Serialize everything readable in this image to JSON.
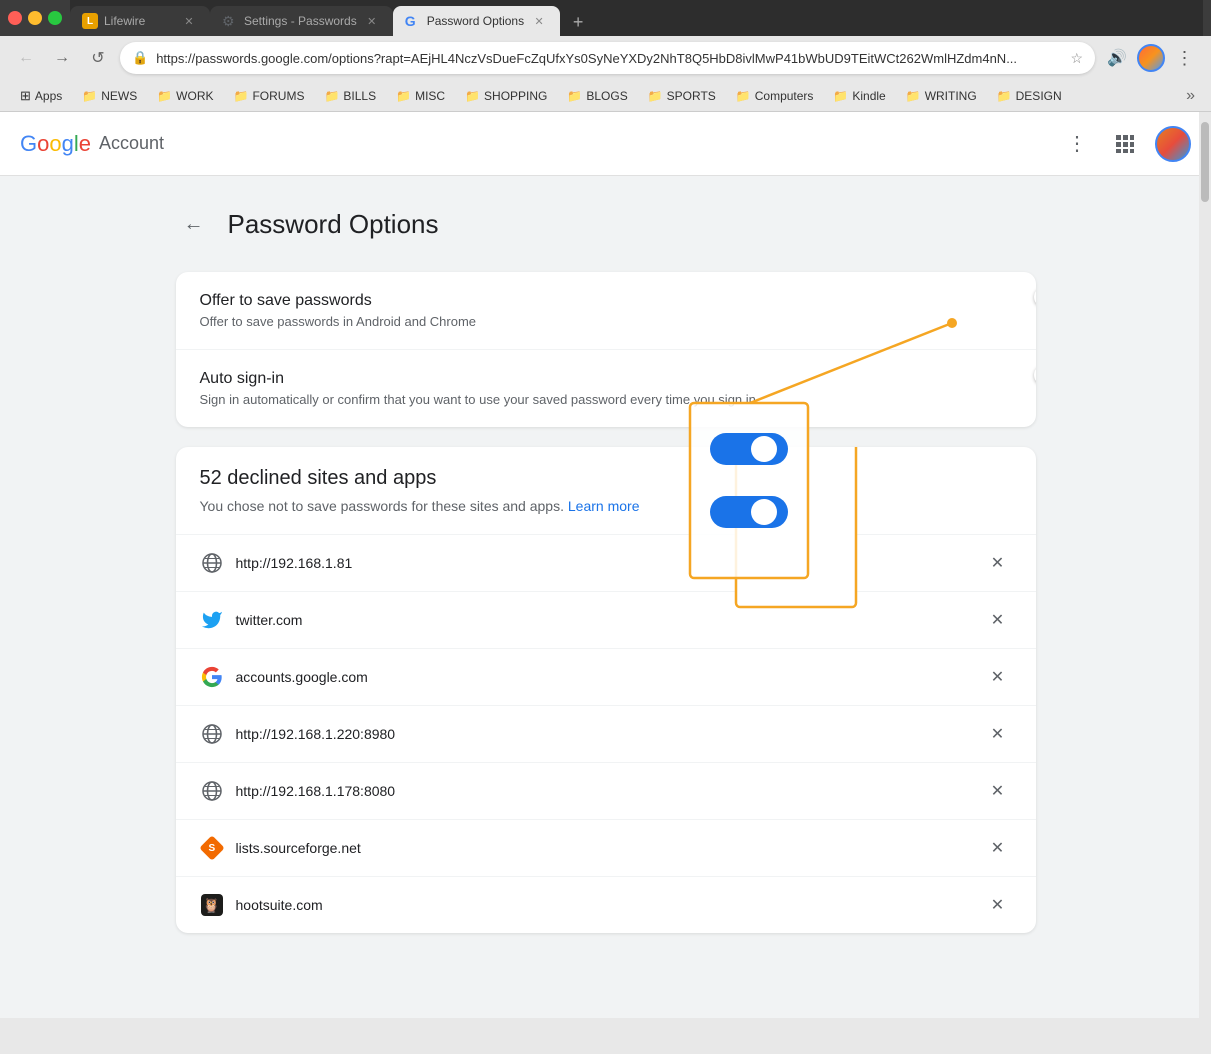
{
  "browser": {
    "tabs": [
      {
        "id": "lifewire",
        "title": "Lifewire",
        "favicon": "L",
        "favicon_color": "#e8a000",
        "active": false
      },
      {
        "id": "settings-passwords",
        "title": "Settings - Passwords",
        "favicon": "⚙",
        "favicon_color": "#5f6368",
        "active": false
      },
      {
        "id": "password-options",
        "title": "Password Options",
        "favicon": "G",
        "favicon_color": "#4285f4",
        "active": true
      }
    ],
    "add_tab_label": "+",
    "url": "https://passwords.google.com/options?rapt=AEjHL4NczVsDueFcZqUfxYs0SyNeYXDy2NhT8Q5HbD8ivlMwP41bWbUD9TEitWCt262WmlHZdm4nN...",
    "nav": {
      "back_label": "←",
      "forward_label": "→",
      "reload_label": "↺"
    }
  },
  "bookmarks": [
    {
      "id": "apps",
      "label": "Apps",
      "type": "apps"
    },
    {
      "id": "news",
      "label": "NEWS",
      "type": "folder"
    },
    {
      "id": "work",
      "label": "WORK",
      "type": "folder"
    },
    {
      "id": "forums",
      "label": "FORUMS",
      "type": "folder"
    },
    {
      "id": "bills",
      "label": "BILLS",
      "type": "folder"
    },
    {
      "id": "misc",
      "label": "MISC",
      "type": "folder"
    },
    {
      "id": "shopping",
      "label": "SHOPPING",
      "type": "folder"
    },
    {
      "id": "blogs",
      "label": "BLOGS",
      "type": "folder"
    },
    {
      "id": "sports",
      "label": "SPORTS",
      "type": "folder"
    },
    {
      "id": "computers",
      "label": "Computers",
      "type": "folder"
    },
    {
      "id": "kindle",
      "label": "Kindle",
      "type": "folder"
    },
    {
      "id": "writing",
      "label": "WRITING",
      "type": "folder"
    },
    {
      "id": "design",
      "label": "DESIGN",
      "type": "folder"
    }
  ],
  "header": {
    "brand_parts": [
      "G",
      "o",
      "o",
      "g",
      "l",
      "e"
    ],
    "brand_text": "Google",
    "account_text": "Account"
  },
  "page": {
    "title": "Password Options",
    "back_label": "←",
    "settings": [
      {
        "id": "offer-save",
        "title": "Offer to save passwords",
        "description": "Offer to save passwords in Android and Chrome",
        "enabled": true
      },
      {
        "id": "auto-signin",
        "title": "Auto sign-in",
        "description": "Sign in automatically or confirm that you want to use your saved password every time you sign in",
        "enabled": true
      }
    ],
    "declined": {
      "title": "52 declined sites and apps",
      "description_before": "You chose not to save passwords for these sites and apps.",
      "learn_more": "Learn more",
      "sites": [
        {
          "id": "site-1",
          "url": "http://192.168.1.81",
          "type": "globe"
        },
        {
          "id": "site-2",
          "url": "twitter.com",
          "type": "twitter"
        },
        {
          "id": "site-3",
          "url": "accounts.google.com",
          "type": "google"
        },
        {
          "id": "site-4",
          "url": "http://192.168.1.220:8980",
          "type": "globe"
        },
        {
          "id": "site-5",
          "url": "http://192.168.1.178:8080",
          "type": "globe"
        },
        {
          "id": "site-6",
          "url": "lists.sourceforge.net",
          "type": "sourceforge"
        },
        {
          "id": "site-7",
          "url": "hootsuite.com",
          "type": "hootsuite"
        }
      ]
    }
  },
  "annotation": {
    "box_label": "toggle highlight",
    "arrow_color": "#f5a623"
  }
}
